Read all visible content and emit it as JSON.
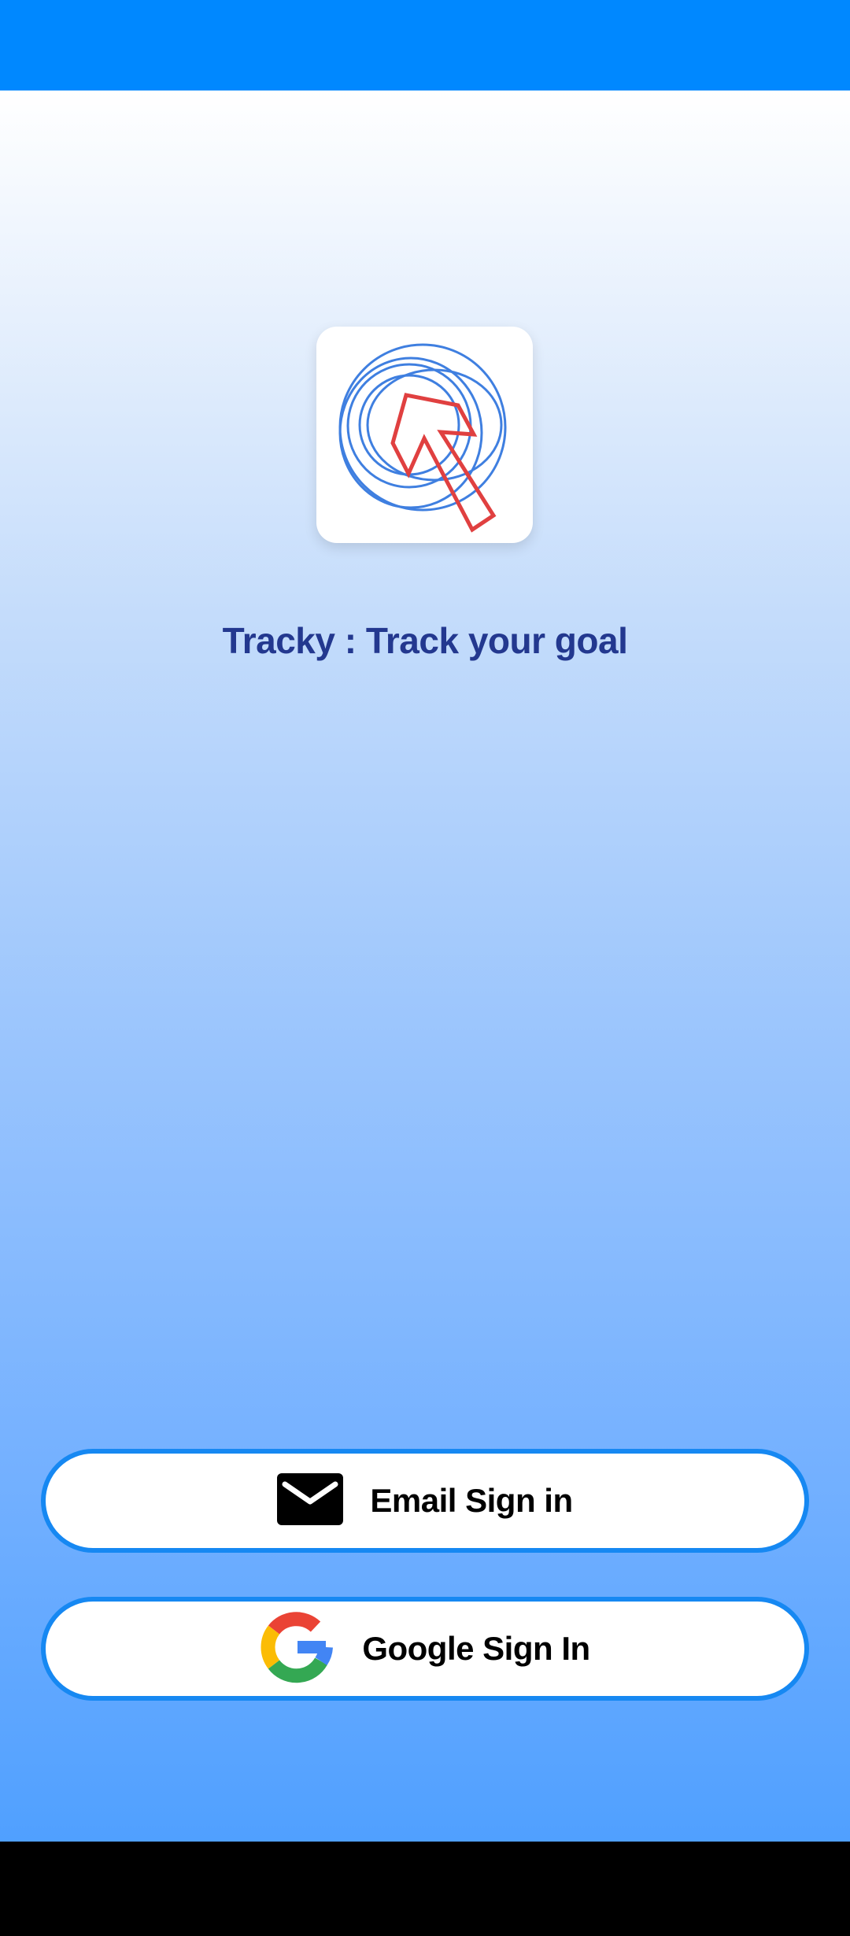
{
  "app": {
    "title": "Tracky : Track your goal"
  },
  "colors": {
    "status_bar": "#0088ff",
    "title_text": "#23388f",
    "button_border": "#1688f2",
    "nav_bar": "#000000"
  },
  "icons": {
    "logo": "target-arrow-logo",
    "email": "envelope-icon",
    "google": "google-g-icon"
  },
  "buttons": {
    "email_label": "Email Sign in",
    "google_label": "Google Sign In"
  }
}
